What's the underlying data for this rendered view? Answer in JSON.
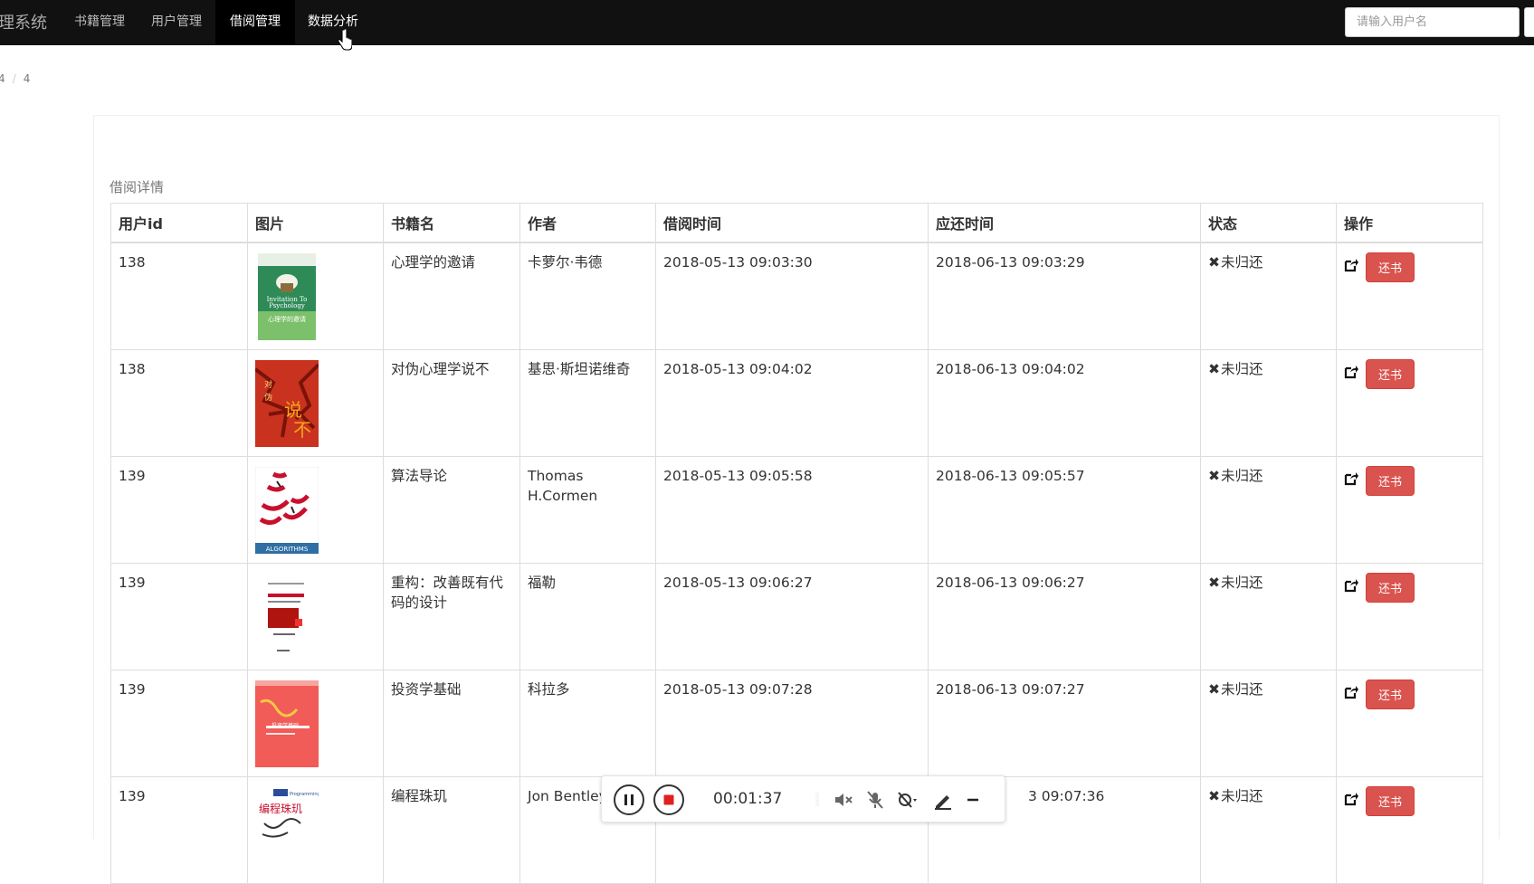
{
  "navbar": {
    "brand": "理系统",
    "items": [
      {
        "label": "书籍管理"
      },
      {
        "label": "用户管理"
      },
      {
        "label": "借阅管理"
      },
      {
        "label": "数据分析"
      }
    ],
    "search_placeholder": "请输入用户名"
  },
  "breadcrumb": {
    "first": "4",
    "second": "4"
  },
  "panel": {
    "title": "借阅详情"
  },
  "table": {
    "headers": [
      "用户id",
      "图片",
      "书籍名",
      "作者",
      "借阅时间",
      "应还时间",
      "状态",
      "操作"
    ],
    "status_icon": "✖",
    "return_label": "还书",
    "rows": [
      {
        "user_id": "138",
        "cover_icon": "psychology-book-cover",
        "book": "心理学的邀请",
        "author": "卡萝尔·韦德",
        "borrow_time": "2018-05-13 09:03:30",
        "due_time": "2018-06-13 09:03:29",
        "status": "未归还"
      },
      {
        "user_id": "138",
        "cover_icon": "say-no-book-cover",
        "book": "对伪心理学说不",
        "author": "基思·斯坦诺维奇",
        "borrow_time": "2018-05-13 09:04:02",
        "due_time": "2018-06-13 09:04:02",
        "status": "未归还"
      },
      {
        "user_id": "139",
        "cover_icon": "algorithms-book-cover",
        "book": "算法导论",
        "author": "Thomas H.Cormen",
        "borrow_time": "2018-05-13 09:05:58",
        "due_time": "2018-06-13 09:05:57",
        "status": "未归还"
      },
      {
        "user_id": "139",
        "cover_icon": "refactoring-book-cover",
        "book": "重构：改善既有代码的设计",
        "author": "福勒",
        "borrow_time": "2018-05-13 09:06:27",
        "due_time": "2018-06-13 09:06:27",
        "status": "未归还"
      },
      {
        "user_id": "139",
        "cover_icon": "investment-book-cover",
        "book": "投资学基础",
        "author": "科拉多",
        "borrow_time": "2018-05-13 09:07:28",
        "due_time": "2018-06-13 09:07:27",
        "status": "未归还"
      },
      {
        "user_id": "139",
        "cover_icon": "programming-pearls-book-cover",
        "book": "编程珠玑",
        "author": "Jon Bentley",
        "borrow_time": "",
        "due_time": "3 09:07:36",
        "status": "未归还"
      }
    ]
  },
  "recorder": {
    "time": "00:01:37"
  },
  "colors": {
    "navbar": "#111111",
    "danger": "#d9534f"
  }
}
